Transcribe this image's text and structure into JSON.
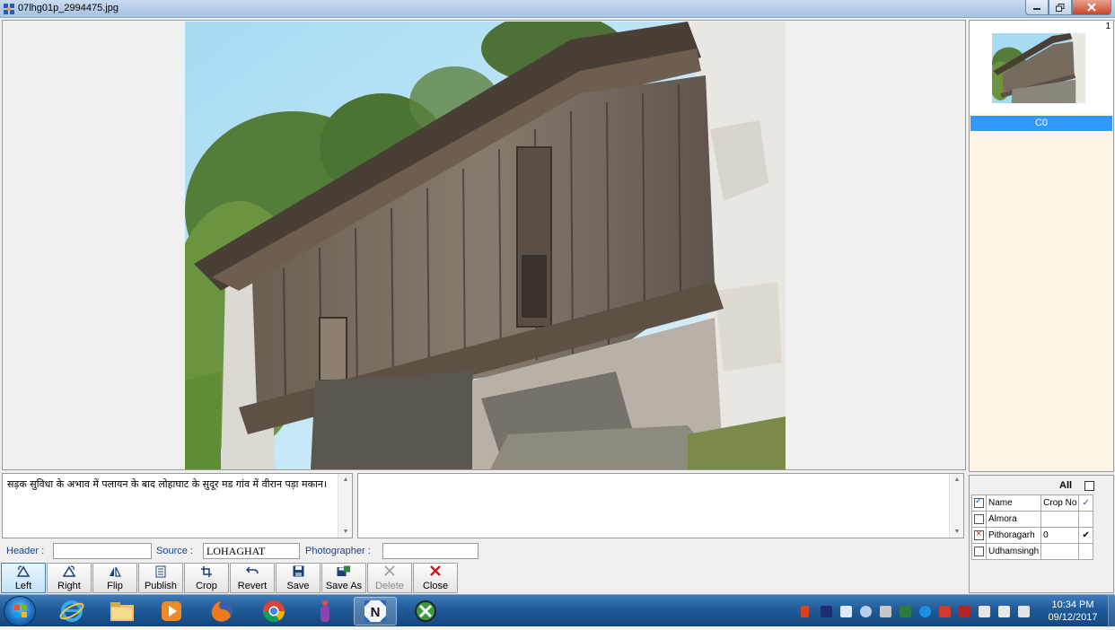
{
  "window": {
    "title": "07lhg01p_2994475.jpg",
    "controls": [
      "minimize",
      "maximize",
      "close"
    ]
  },
  "thumbnails": {
    "count": "1",
    "items": [
      {
        "label": "C0"
      }
    ]
  },
  "caption": {
    "text": "सड़क सुविधा के अभाव में पलायन के बाद लोहाघाट के सुदूर मड गांव में वीरान पड़ा मकान।"
  },
  "notes": {
    "text": ""
  },
  "fields": {
    "header_label": "Header :",
    "header_value": "",
    "source_label": "Source :",
    "source_value": "LOHAGHAT",
    "photographer_label": "Photographer :",
    "photographer_value": ""
  },
  "toolbar": {
    "left": "Left",
    "right": "Right",
    "flip": "Flip",
    "publish": "Publish",
    "crop": "Crop",
    "revert": "Revert",
    "save": "Save",
    "save_as": "Save As",
    "delete": "Delete",
    "close": "Close"
  },
  "districts": {
    "all_label": "All",
    "columns": {
      "name": "Name",
      "crop_no": "Crop No"
    },
    "rows": [
      {
        "name": "Almora",
        "crop_no": "",
        "checked": false,
        "tick": ""
      },
      {
        "name": "Pithoragarh",
        "crop_no": "0",
        "checked": true,
        "tick": "✔"
      },
      {
        "name": "Udhamsingh",
        "crop_no": "",
        "checked": false,
        "tick": ""
      }
    ]
  },
  "taskbar": {
    "apps": [
      "start-orb",
      "internet-explorer",
      "file-explorer",
      "media-player",
      "firefox",
      "chrome",
      "app-purple",
      "n-app",
      "x-app"
    ],
    "clock_time": "10:34 PM",
    "clock_date": "09/12/2017"
  },
  "colors": {
    "selection": "#3399ff",
    "thumb_panel": "#fdf5e6",
    "taskbar": "#205c9a",
    "close_icon": "#c8181e"
  }
}
